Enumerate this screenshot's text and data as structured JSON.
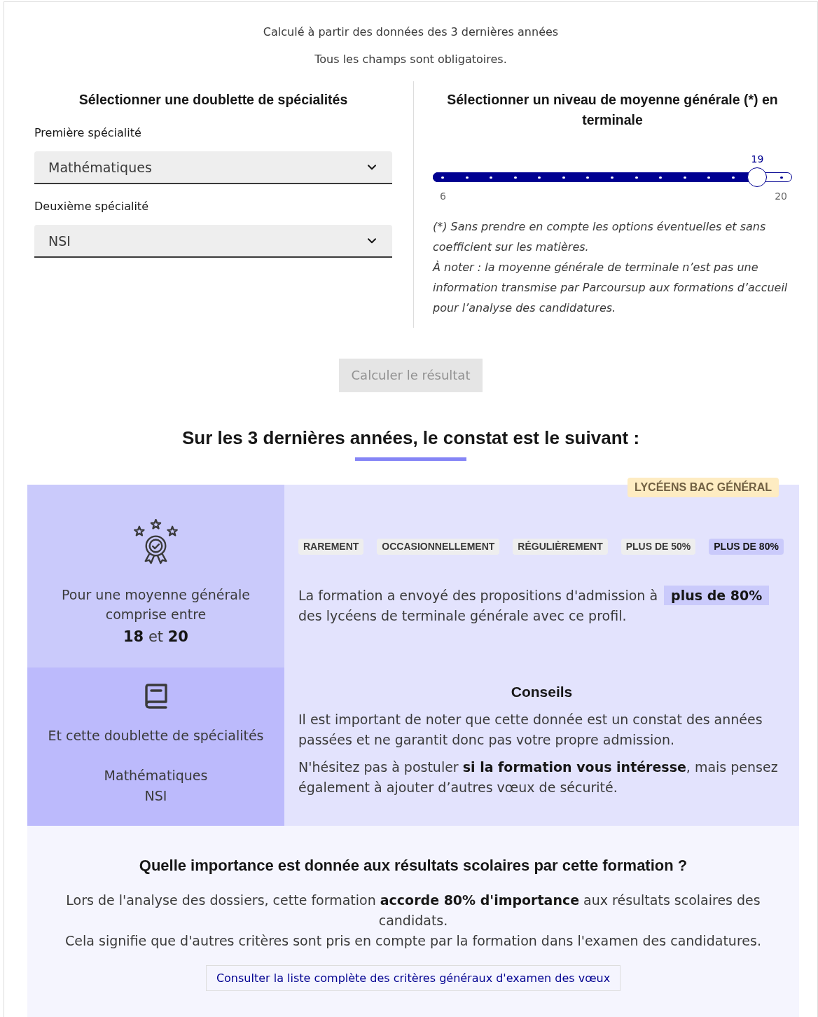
{
  "intro": {
    "subtitle": "Calculé à partir des données des 3 dernières années",
    "required_note": "Tous les champs sont obligatoires."
  },
  "specialties_form": {
    "title": "Sélectionner une doublette de spécialités",
    "fields": [
      {
        "label": "Première spécialité",
        "value": "Mathématiques"
      },
      {
        "label": "Deuxième spécialité",
        "value": "NSI"
      }
    ]
  },
  "average_form": {
    "title": "Sélectionner un niveau de moyenne générale (*) en terminale",
    "slider": {
      "level": 0.9286,
      "reading": "19",
      "min_label": "6",
      "max_label": "20"
    },
    "notes": [
      "(*) Sans prendre en compte les options éventuelles et sans coefficient sur les matières.",
      "À noter : la moyenne générale de terminale n’est pas une information transmise par Parcoursup aux formations d’accueil pour l’analyse des candidatures."
    ]
  },
  "calculate_button": {
    "label": "Calculer le résultat",
    "disabled": true
  },
  "result": {
    "title": "Sur les 3 dernières années, le constat est le suivant :",
    "badge": "LYCÉENS BAC GÉNÉRAL",
    "average_panel": {
      "text": "Pour une moyenne générale comprise entre",
      "range": "**18** et **20**"
    },
    "frequency_tags": [
      {
        "label": "RAREMENT",
        "selected": false
      },
      {
        "label": "OCCASIONNELLEMENT",
        "selected": false
      },
      {
        "label": "RÉGULIÈREMENT",
        "selected": false
      },
      {
        "label": "PLUS DE 50%",
        "selected": false
      },
      {
        "label": "PLUS DE 80%",
        "selected": true
      }
    ],
    "statement": "La formation a envoyé des propositions d'admission à **plus de 80%** des lycéens de terminale générale avec ce profil.",
    "specialties_panel": {
      "text": "Et cette doublette de spécialités",
      "specialties": [
        "Mathématiques",
        "NSI"
      ]
    },
    "advice": {
      "title": "Conseils",
      "paragraphs": [
        "Il est important de noter que cette donnée est un constat des années passées et ne garantit donc pas votre propre admission.",
        "N'hésitez pas à postuler **si la formation vous intéresse**, mais pensez également à ajouter d’autres vœux de sécurité."
      ]
    }
  },
  "importance": {
    "title": "Quelle importance est donnée aux résultats scolaires par cette formation ?",
    "paragraphs": [
      "Lors de l'analyse des dossiers, cette formation **accorde 80% d'importance** aux résultats scolaires des candidats.",
      "Cela signifie que d'autres critères sont pris en compte par la formation dans l'examen des candidatures."
    ],
    "link": "Consulter la liste complète des critères généraux d'examen des vœux"
  }
}
